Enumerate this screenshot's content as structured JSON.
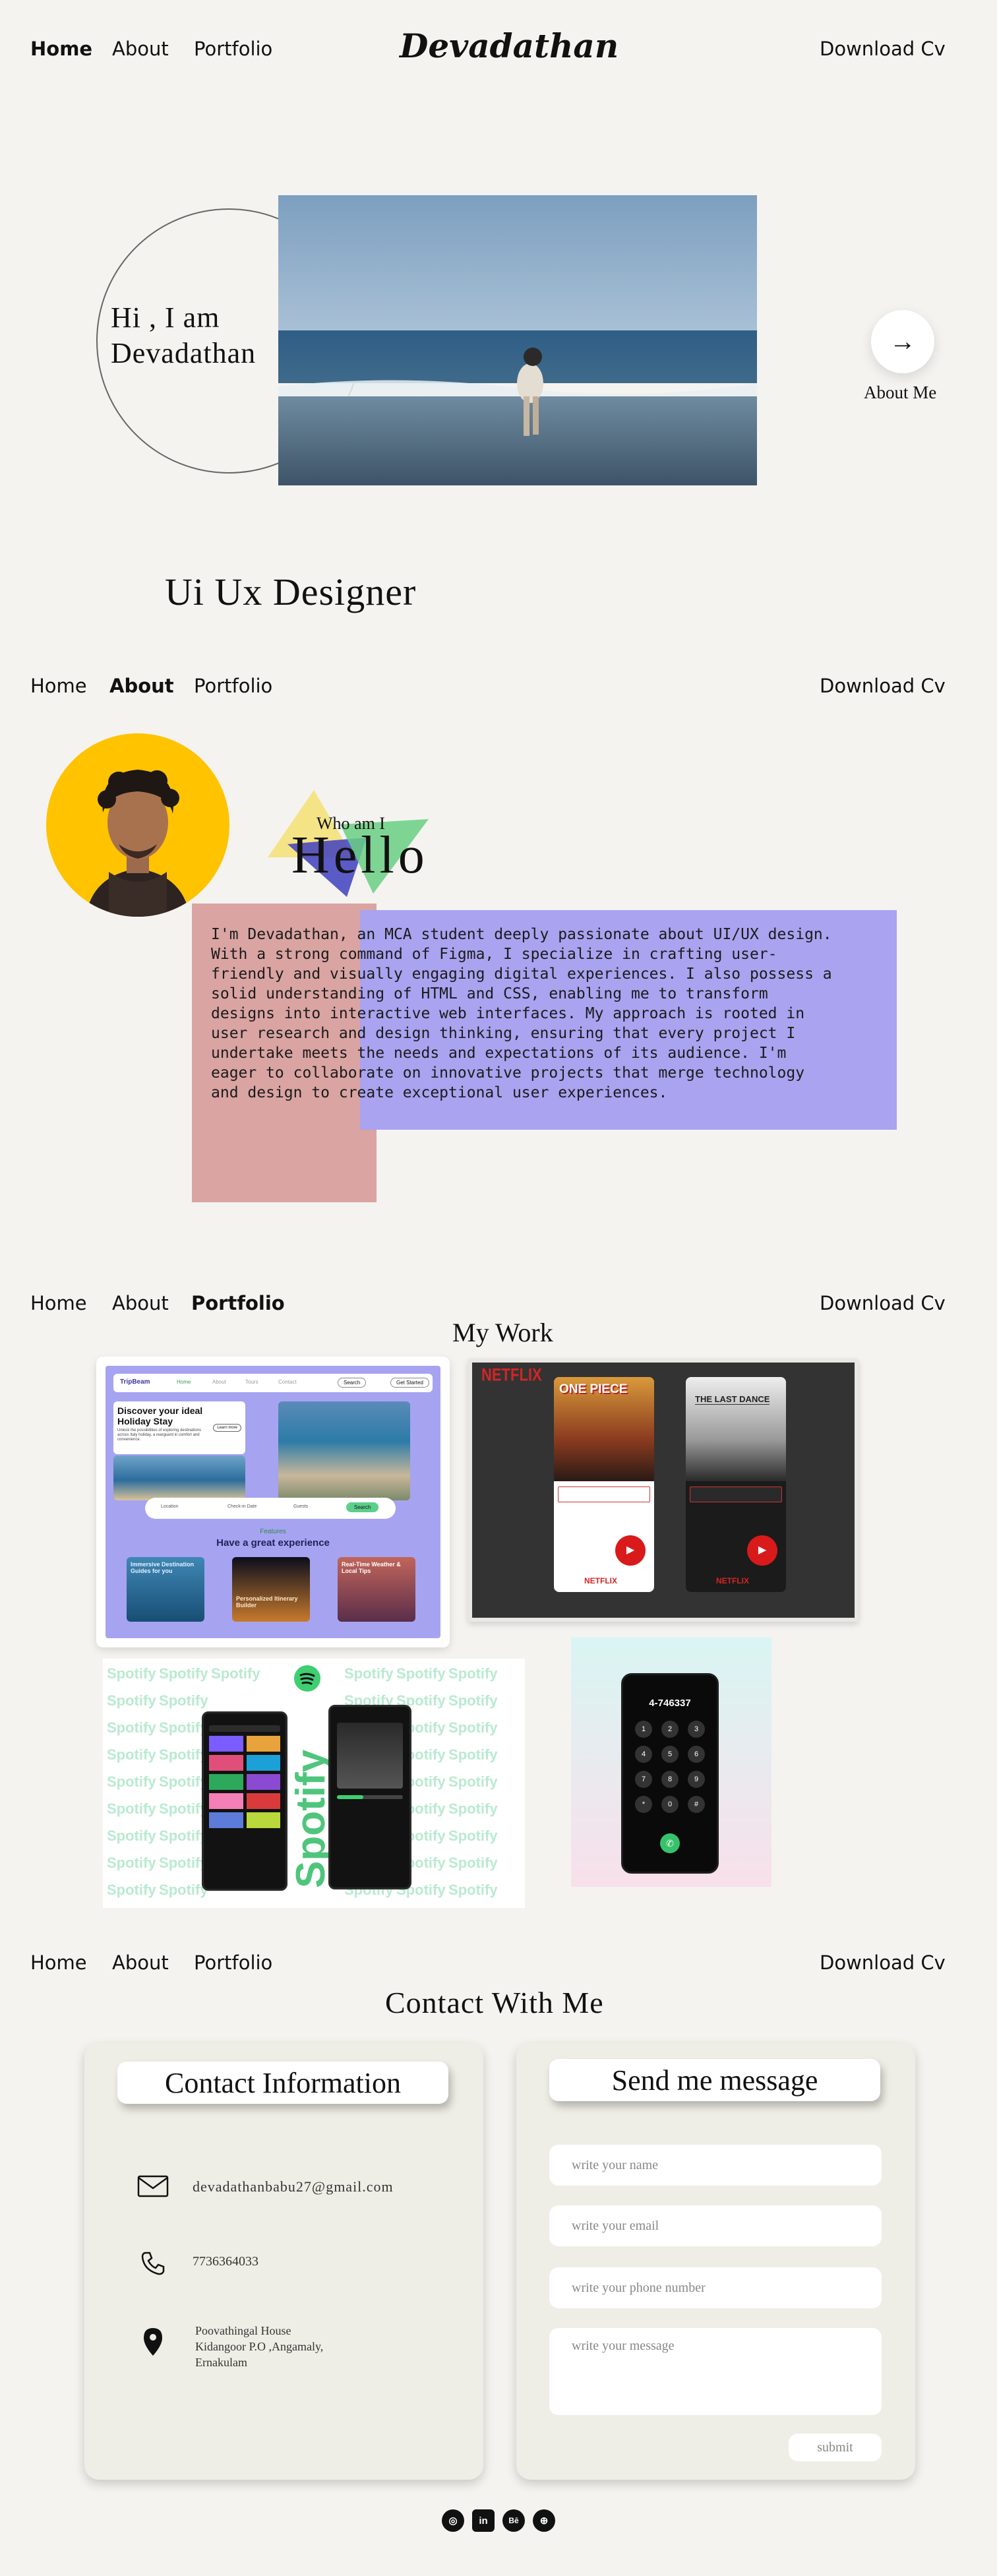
{
  "nav_hero": {
    "home": "Home",
    "about": "About",
    "portfolio": "Portfolio",
    "logo": "Devadathan",
    "download": "Download Cv"
  },
  "hero": {
    "greeting_line1": "Hi , I am",
    "greeting_line2": "Devadathan",
    "about_me": "About Me",
    "role": "Ui Ux Designer",
    "arrow": "→"
  },
  "nav_about": {
    "home": "Home",
    "about": "About",
    "portfolio": "Portfolio",
    "download": "Download Cv"
  },
  "about": {
    "who": "Who am I",
    "hello": "Hello",
    "bio": "I'm Devadathan, an MCA student deeply passionate about UI/UX design. With a strong command of Figma, I specialize in crafting user-friendly and visually engaging digital experiences. I also possess a solid understanding of HTML and CSS, enabling me to transform designs into interactive web interfaces. My approach is rooted in user research and design thinking, ensuring that every project I undertake meets the needs and expectations of its audience. I'm eager to collaborate on innovative projects that merge technology and design to create exceptional user experiences."
  },
  "nav_portfolio": {
    "home": "Home",
    "about": "About",
    "portfolio": "Portfolio",
    "download": "Download Cv"
  },
  "portfolio": {
    "title": "My Work",
    "travel": {
      "brand": "TripBeam",
      "nav_links": [
        "Home",
        "About",
        "Tours",
        "Contact"
      ],
      "search": "Search",
      "cta": "Get Started",
      "headline": "Discover your ideal Holiday Stay",
      "sub": "Unlock the possibilities of exploring destinations across Italy holiday, a rearguard in comfort and convenience.",
      "btn": "Learn more",
      "filters": [
        "Location",
        "Check-in Date",
        "Guests"
      ],
      "search_btn": "Search",
      "features_label": "Features",
      "features_title": "Have a great experience",
      "feature_cards": [
        "Immersive Destination Guides for you",
        "Personalized Itinerary Builder",
        "Real-Time Weather & Local Tips"
      ]
    },
    "netflix": {
      "logo": "NETFLIX",
      "poster1": "ONE PIECE",
      "poster2": "THE LAST DANCE",
      "footer": "NETFLIX"
    },
    "spotify": {
      "repeat": "Spotify",
      "vertical": "Spotify"
    },
    "dialer": {
      "number": "4-746337",
      "keys": [
        "1",
        "2",
        "3",
        "4",
        "5",
        "6",
        "7",
        "8",
        "9",
        "*",
        "0",
        "#"
      ]
    }
  },
  "nav_contact": {
    "home": "Home",
    "about": "About",
    "portfolio": "Portfolio",
    "download": "Download Cv"
  },
  "contact": {
    "title": "Contact With Me",
    "info_title": "Contact Information",
    "email": "devadathanbabu27@gmail.com",
    "phone": "7736364033",
    "address_line1": "Poovathingal House",
    "address_line2": "Kidangoor P.O ,Angamaly,",
    "address_line3": "Ernakulam",
    "send_title": "Send me message",
    "ph_name": "write your name",
    "ph_email": "write your email",
    "ph_phone": "write your phone number",
    "ph_message": "write your message",
    "submit": "submit"
  },
  "social": [
    "instagram-icon",
    "linkedin-icon",
    "behance-icon",
    "dribbble-icon"
  ],
  "social_labels": {
    "instagram": "◎",
    "linkedin": "in",
    "behance": "Bē",
    "dribbble": "⊕"
  },
  "colors": {
    "bg": "#f4f3ef",
    "accent_yellow": "#ffc300",
    "purple": "#a9a3f0",
    "rose": "#d9a4a2",
    "green": "#5ccf8a"
  }
}
